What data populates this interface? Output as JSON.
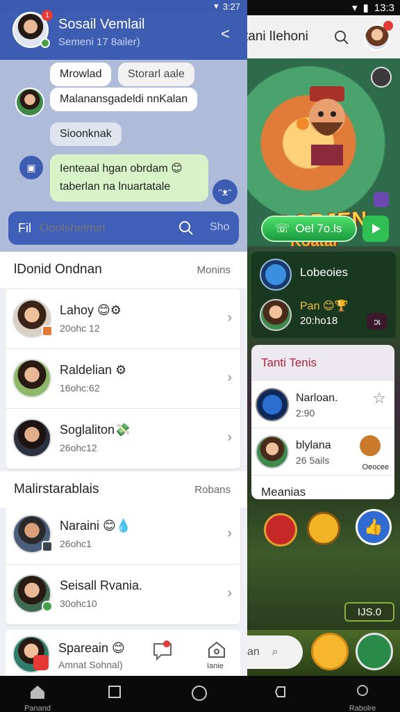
{
  "chat": {
    "status_time": "3:27",
    "header": {
      "title": "Sosail Vemlail",
      "subtitle": "Semeni 17 8ailer)",
      "badge": "1"
    },
    "messages": [
      "Mrowlad",
      "Storarl aale",
      "Malanansgadeldi nnKalan",
      "Sioonknak",
      "Ienteaal hgan obrdam 😊 taberlan na lnuartatale"
    ],
    "search": {
      "label": "Fil",
      "placeholder": "Ooolshelmin",
      "go_label": "Sho"
    },
    "section1": {
      "title": "lDonid Ondnan",
      "link": "Monins"
    },
    "section2": {
      "title": "Malirstarablais",
      "link": "Robans"
    },
    "contacts1": [
      {
        "name": "Lahoy 😊⚙",
        "sub": "20ohc 12",
        "mark": "#e07a34"
      },
      {
        "name": "Raldelian ⚙",
        "sub": "16ohc:62",
        "mark": ""
      },
      {
        "name": "Soglaliton💸",
        "sub": "26ohc12",
        "mark": ""
      }
    ],
    "contacts2": [
      {
        "name": "Naraini 😊💧",
        "sub": "26ohc1",
        "mark": "#37474f"
      },
      {
        "name": "Seisall Rvania.",
        "sub": "30ohc10",
        "mark": "#43a047"
      }
    ],
    "bottom": {
      "name": "Spareain 😊",
      "sub": "Amnat Sohnal)",
      "home_label": "Ianie"
    }
  },
  "game": {
    "status_time": "13:3",
    "title": "tani lIehoni",
    "logo_line1": "BOPJEN",
    "logo_line2": "Koatal",
    "play_label": "Oel 7o.ls",
    "row1_label": "Lobeoies",
    "row2_label": "Pan 😊🏆",
    "row2_sub": "20:ho18",
    "row2_btn": "ɔɩ",
    "card": {
      "title": "Tanti Tenis",
      "rows": [
        {
          "name": "Narloan.",
          "sub": "2:90"
        },
        {
          "name": "blylana",
          "sub": "26 5ails",
          "extra": "Oeocee"
        }
      ],
      "footer": "Meanias"
    },
    "counter": "IJS.0",
    "search_text": "an"
  },
  "navbar": {
    "items": [
      {
        "label": "Panand"
      },
      {
        "label": ""
      },
      {
        "label": ""
      },
      {
        "label": ""
      },
      {
        "label": "Rabolre"
      }
    ]
  }
}
